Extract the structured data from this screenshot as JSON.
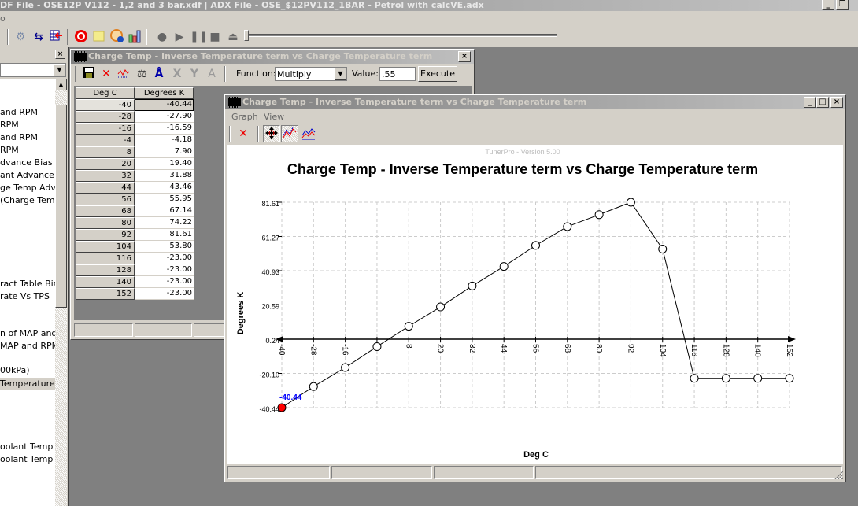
{
  "app": {
    "title": "DF File - OSE12P V112 - 1,2 and 3 bar.xdf | ADX File - OSE_$12PV112_1BAR - Petrol with calcVE.adx",
    "menu_fragment": "o"
  },
  "main_toolbar": {
    "icons": [
      "settings-gears-icon",
      "swap-arrows-icon",
      "table-import-icon",
      "emulator-target-icon",
      "notepad-icon",
      "info-gauge-icon",
      "bar-chart-icon",
      "record-icon",
      "play-icon",
      "pause-icon",
      "stop-icon",
      "eject-icon"
    ],
    "slider_value": 0
  },
  "left_panel": {
    "close_glyph": "×",
    "tree_items": [
      {
        "label": "and RPM"
      },
      {
        "label": "RPM"
      },
      {
        "label": "and RPM"
      },
      {
        "label": "RPM"
      },
      {
        "label": "dvance Bias Ter"
      },
      {
        "label": "ant Advance B"
      },
      {
        "label": "ge Temp Advai"
      },
      {
        "label": " (Charge Temp"
      },
      {
        "label": "ract Table Bias)"
      },
      {
        "label": "rate Vs TPS"
      },
      {
        "label": "n of MAP and F"
      },
      {
        "label": "MAP and RPM"
      },
      {
        "label": "00kPa)"
      },
      {
        "label": "Temperature t",
        "selected": true
      },
      {
        "label": "oolant Temp"
      },
      {
        "label": "oolant Temp"
      }
    ]
  },
  "table_window": {
    "title": "Charge Temp - Inverse Temperature term vs Charge Temperature term",
    "function_label": "Function:",
    "function_value": "Multiply",
    "value_label": "Value:",
    "value_input": ".55",
    "execute_label": "Execute",
    "col_headers": [
      "Deg C",
      "Degrees K"
    ],
    "rows": [
      {
        "x": "-40",
        "y": "-40.44"
      },
      {
        "x": "-28",
        "y": "-27.90"
      },
      {
        "x": "-16",
        "y": "-16.59"
      },
      {
        "x": "-4",
        "y": "-4.18"
      },
      {
        "x": "8",
        "y": "7.90"
      },
      {
        "x": "20",
        "y": "19.40"
      },
      {
        "x": "32",
        "y": "31.88"
      },
      {
        "x": "44",
        "y": "43.46"
      },
      {
        "x": "56",
        "y": "55.95"
      },
      {
        "x": "68",
        "y": "67.14"
      },
      {
        "x": "80",
        "y": "74.22"
      },
      {
        "x": "92",
        "y": "81.61"
      },
      {
        "x": "104",
        "y": "53.80"
      },
      {
        "x": "116",
        "y": "-23.00"
      },
      {
        "x": "128",
        "y": "-23.00"
      },
      {
        "x": "140",
        "y": "-23.00"
      },
      {
        "x": "152",
        "y": "-23.00"
      }
    ]
  },
  "graph_window": {
    "title": "Charge Temp - Inverse Temperature term vs Charge Temperature term",
    "menu": [
      "Graph",
      "View"
    ],
    "watermark": "TunerPro - Version 5.00"
  },
  "chart_data": {
    "type": "line",
    "title": "Charge Temp - Inverse Temperature term vs Charge Temperature term",
    "xlabel": "Deg C",
    "ylabel": "Degrees K",
    "x": [
      -40,
      -28,
      -16,
      -4,
      8,
      20,
      32,
      44,
      56,
      68,
      80,
      92,
      104,
      116,
      128,
      140,
      152
    ],
    "y": [
      -40.44,
      -27.9,
      -16.59,
      -4.18,
      7.9,
      19.4,
      31.88,
      43.46,
      55.95,
      67.14,
      74.22,
      81.61,
      53.8,
      -23.0,
      -23.0,
      -23.0,
      -23.0
    ],
    "x_ticks": [
      "-40",
      "-28",
      "-16",
      "-4",
      "8",
      "20",
      "32",
      "44",
      "56",
      "68",
      "80",
      "92",
      "104",
      "116",
      "128",
      "140",
      "152"
    ],
    "y_ticks": [
      "81.61",
      "61.27",
      "40.93",
      "20.59",
      "0.24",
      "-20.10",
      "-40.44"
    ],
    "xlim": [
      -40,
      152
    ],
    "ylim": [
      -40.44,
      81.61
    ],
    "grid": true,
    "selected_point": {
      "index": 0,
      "label": "-40.44",
      "color": "#ff0000"
    },
    "label_color": "#0000ff"
  }
}
